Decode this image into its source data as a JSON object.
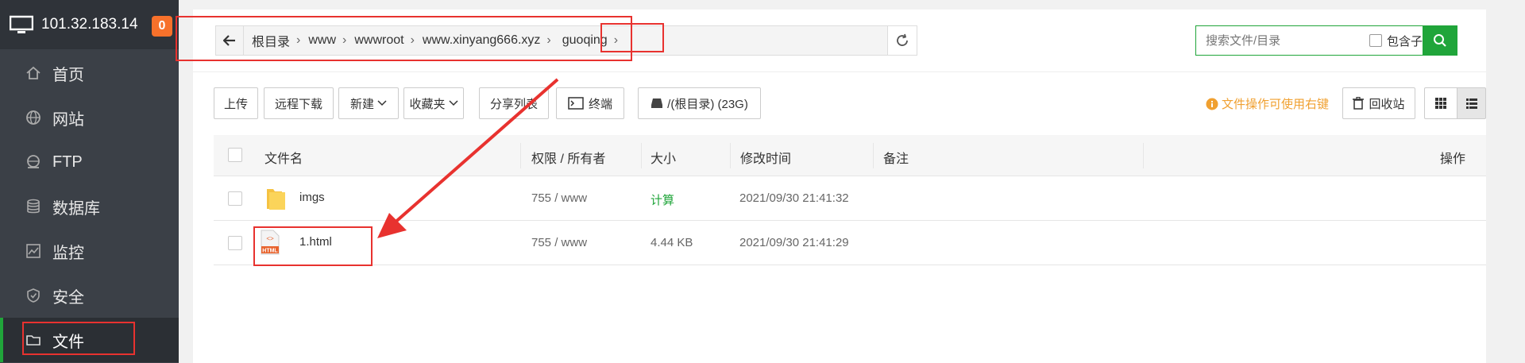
{
  "sidebar": {
    "ip": "101.32.183.14",
    "badge": "0",
    "items": [
      {
        "label": "首页",
        "icon": "home-icon"
      },
      {
        "label": "网站",
        "icon": "globe-icon"
      },
      {
        "label": "FTP",
        "icon": "ftp-icon"
      },
      {
        "label": "数据库",
        "icon": "database-icon"
      },
      {
        "label": "监控",
        "icon": "monitor-icon"
      },
      {
        "label": "安全",
        "icon": "shield-icon"
      },
      {
        "label": "文件",
        "icon": "folder-icon"
      }
    ]
  },
  "address": {
    "crumbs": [
      "根目录",
      "www",
      "wwwroot",
      "www.xinyang666.xyz",
      "guoqing"
    ]
  },
  "search": {
    "placeholder": "搜索文件/目录",
    "checkbox_label": "包含子目录"
  },
  "toolbar": {
    "upload": "上传",
    "remote_download": "远程下载",
    "new": "新建",
    "favorites": "收藏夹",
    "share_list": "分享列表",
    "terminal": "终端",
    "disk": "/(根目录) (23G)",
    "tip": "文件操作可使用右键",
    "recycle": "回收站"
  },
  "table": {
    "headers": {
      "name": "文件名",
      "perm": "权限 / 所有者",
      "size": "大小",
      "mtime": "修改时间",
      "note": "备注",
      "ops": "操作"
    },
    "rows": [
      {
        "name": "imgs",
        "perm": "755 / www",
        "size": "计算",
        "mtime": "2021/09/30 21:41:32",
        "type": "folder"
      },
      {
        "name": "1.html",
        "perm": "755 / www",
        "size": "4.44 KB",
        "mtime": "2021/09/30 21:41:29",
        "type": "html"
      }
    ]
  },
  "colors": {
    "accent": "#20a53a",
    "annotation": "#e8322f",
    "sidebar": "#3b4047",
    "badge": "#f7712b"
  }
}
